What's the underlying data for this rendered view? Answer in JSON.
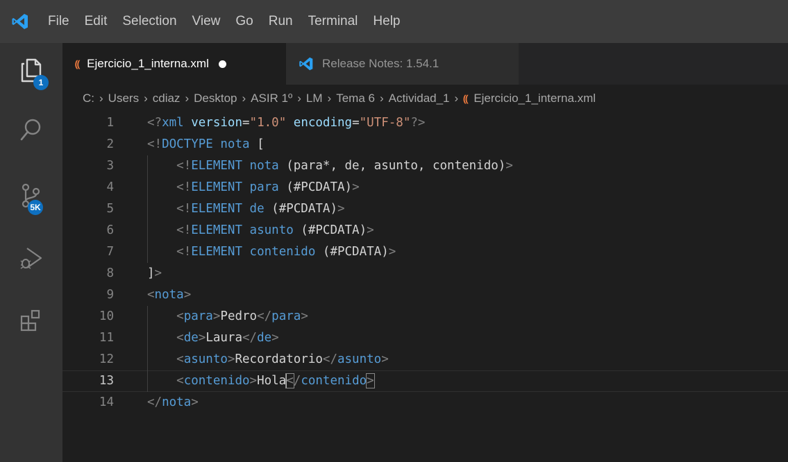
{
  "menu": [
    "File",
    "Edit",
    "Selection",
    "View",
    "Go",
    "Run",
    "Terminal",
    "Help"
  ],
  "activity": {
    "explorer_badge": "1",
    "scm_badge": "5K"
  },
  "tabs": [
    {
      "label": "Ejercicio_1_interna.xml",
      "modified": true
    },
    {
      "label": "Release Notes: 1.54.1"
    }
  ],
  "breadcrumb": [
    "C:",
    "Users",
    "cdiaz",
    "Desktop",
    "ASIR 1º",
    "LM",
    "Tema 6",
    "Actividad_1",
    "Ejercicio_1_interna.xml"
  ],
  "editor": {
    "line_numbers": [
      "1",
      "2",
      "3",
      "4",
      "5",
      "6",
      "7",
      "8",
      "9",
      "10",
      "11",
      "12",
      "13",
      "14"
    ],
    "current_line": "13",
    "lines": [
      "<?xml version=\"1.0\" encoding=\"UTF-8\"?>",
      "<!DOCTYPE nota [",
      "    <!ELEMENT nota (para*, de, asunto, contenido)>",
      "    <!ELEMENT para (#PCDATA)>",
      "    <!ELEMENT de (#PCDATA)>",
      "    <!ELEMENT asunto (#PCDATA)>",
      "    <!ELEMENT contenido (#PCDATA)>",
      "]>",
      "<nota>",
      "    <para>Pedro</para>",
      "    <de>Laura</de>",
      "    <asunto>Recordatorio</asunto>",
      "    <contenido>Hola</contenido>",
      "</nota>"
    ]
  },
  "colors": {
    "titlebar": "#3c3c3c",
    "activitybar": "#333333",
    "editor_bg": "#1e1e1e",
    "tag": "#569cd6",
    "attribute": "#9cdcfe",
    "string": "#ce9178",
    "text": "#d4d4d4",
    "badge": "#0e70c0"
  }
}
